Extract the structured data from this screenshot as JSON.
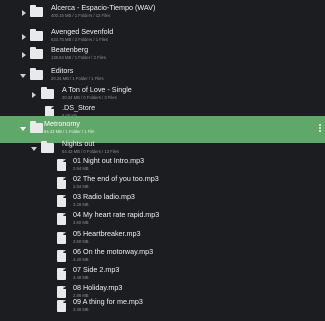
{
  "tree": {
    "rows": [
      {
        "type": "folder",
        "expanded": false,
        "name": "Alcerca - Espacio-Tiempo (WAV)",
        "meta": "400.15 MB / 1 Folders / 12 Files"
      },
      {
        "type": "folder",
        "expanded": false,
        "name": "Avenged Sevenfold",
        "meta": "633.75 MB / 2 Folders / 1 Files"
      },
      {
        "type": "folder",
        "expanded": false,
        "name": "Beatenberg",
        "meta": "138.54 MB / 1 Folder / 2 Files"
      },
      {
        "type": "folder",
        "expanded": true,
        "name": "Editors",
        "meta": "20.34 MB / 1 Folder / 1 Files"
      },
      {
        "type": "folder",
        "expanded": false,
        "name": "A Ton of Love - Single",
        "meta": "20.34 MB / 0 Folders / 3 Files"
      },
      {
        "type": "file",
        "name": ".DS_Store",
        "meta": "6.00 KB"
      },
      {
        "type": "folder",
        "expanded": true,
        "selected": true,
        "name": "Metronomy",
        "meta": "64.43 MB / 1 Folder / 1 File"
      },
      {
        "type": "folder",
        "expanded": true,
        "name": "Nights out",
        "meta": "64.43 MB / 0 Folders / 13 Files"
      },
      {
        "type": "file",
        "name": "01 Night out Intro.mp3",
        "meta": "2.94 MB"
      },
      {
        "type": "file",
        "name": "02 The end of you too.mp3",
        "meta": "2.84 MB"
      },
      {
        "type": "file",
        "name": "03 Radio ladio.mp3",
        "meta": "3.28 MB"
      },
      {
        "type": "file",
        "name": "04 My heart rate rapid.mp3",
        "meta": "3.60 MB"
      },
      {
        "type": "file",
        "name": "05 Heartbreaker.mp3",
        "meta": "3.60 MB"
      },
      {
        "type": "file",
        "name": "06 On the motorway.mp3",
        "meta": "4.30 MB"
      },
      {
        "type": "file",
        "name": "07 Side 2.mp3",
        "meta": "3.48 MB"
      },
      {
        "type": "file",
        "name": "08 Holiday.mp3",
        "meta": "2.86 MB"
      },
      {
        "type": "file",
        "name": "09 A thing for me.mp3",
        "meta": "3.36 MB"
      }
    ]
  },
  "icons": {
    "folder": "folder-icon",
    "file": "file-icon",
    "expanded": "chevron-down-icon",
    "collapsed": "chevron-right-icon",
    "more": "more-vertical-icon"
  },
  "colors": {
    "background": "#1b1d21",
    "selected_row": "#5fa86a",
    "text_primary": "#f0f0f0",
    "text_secondary": "#8a8d91"
  }
}
